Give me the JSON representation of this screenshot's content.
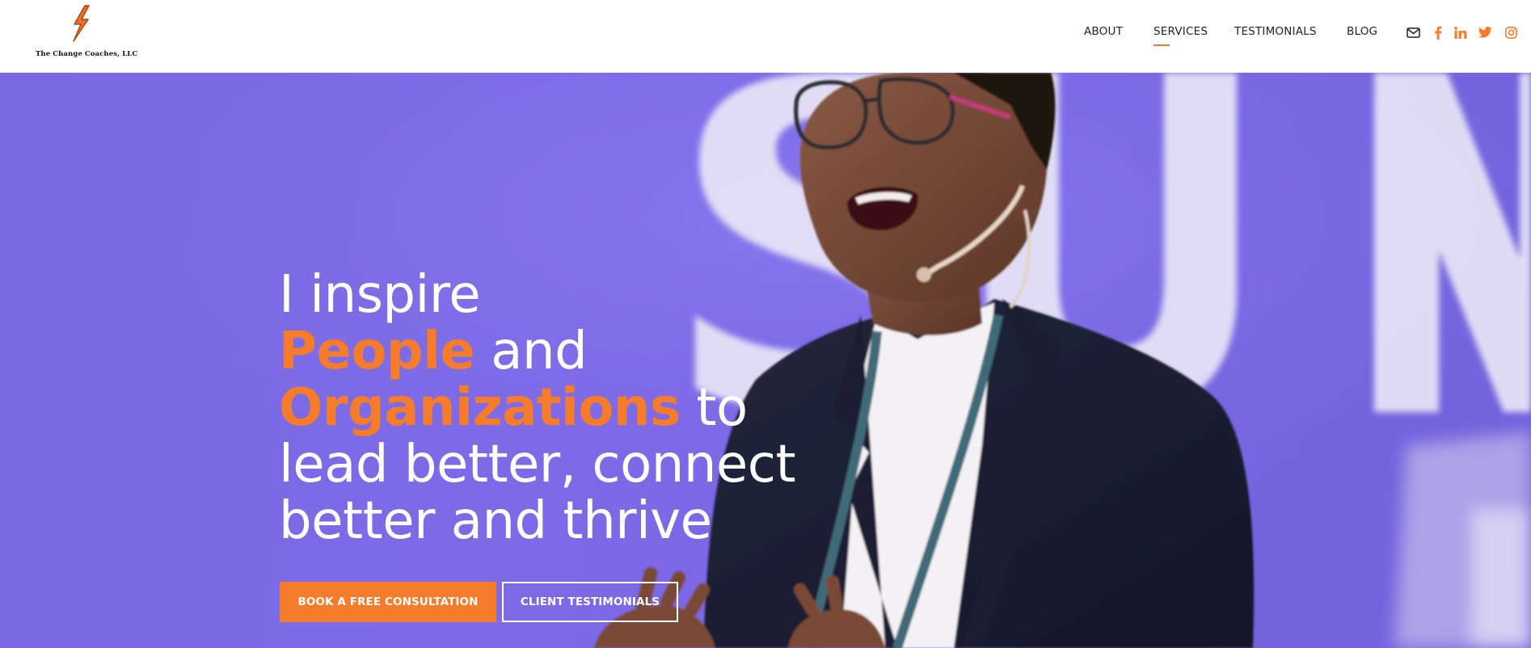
{
  "brand": {
    "name": "The Change Coaches, LLC",
    "logo_icon": "lightning-bolt-icon",
    "accent_color": "#f47c2a"
  },
  "nav": {
    "items": [
      {
        "label": "ABOUT",
        "active": false
      },
      {
        "label": "SERVICES",
        "active": true
      },
      {
        "label": "TESTIMONIALS",
        "active": false
      },
      {
        "label": "BLOG",
        "active": false
      }
    ],
    "social_icons": [
      "envelope-icon",
      "facebook-icon",
      "linkedin-icon",
      "twitter-icon",
      "instagram-icon"
    ]
  },
  "hero": {
    "background_color": "#7b68e3",
    "headline": {
      "line1": "I inspire",
      "people": "People",
      "and": " and",
      "organizations": "Organizations",
      "to": " to",
      "line4": "lead better, connect",
      "line5": "better and thrive"
    },
    "primary_button": "BOOK A FREE CONSULTATION",
    "secondary_button": "CLIENT TESTIMONIALS",
    "image": "speaker-with-headset-microphone"
  }
}
